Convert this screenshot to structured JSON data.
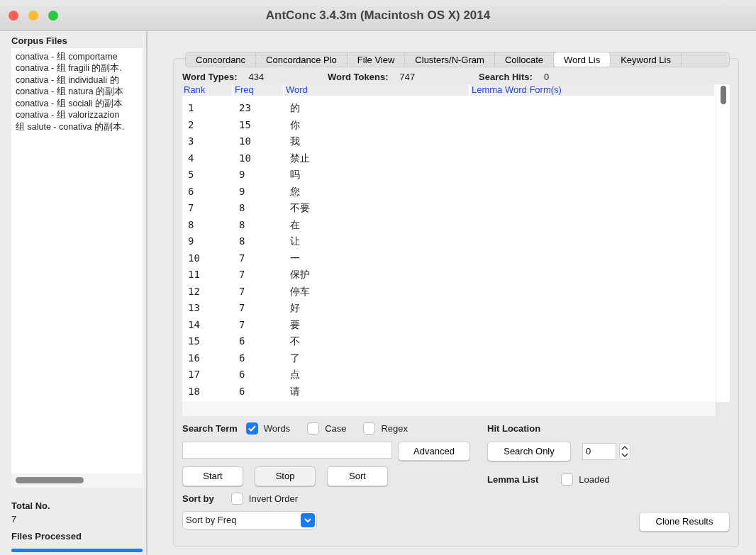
{
  "window": {
    "title": "AntConc 3.4.3m (Macintosh OS X) 2014"
  },
  "corpus_files": {
    "heading": "Corpus Files",
    "files": [
      "conativa - 组 comportame",
      "conativa - 组 fragili 的副本.",
      "conativa - 组 individuali 的",
      "conativa - 组 natura 的副本",
      "conativa - 组 sociali 的副本",
      "conativa - 组 valorizzazion",
      "组 salute - conativa 的副本."
    ]
  },
  "totals": {
    "total_label": "Total No.",
    "total_value": "7",
    "processed_label": "Files Processed",
    "level": 1
  },
  "tabs": [
    {
      "label": "Concordanc",
      "selected": false
    },
    {
      "label": "Concordance Plo",
      "selected": false
    },
    {
      "label": "File View",
      "selected": false
    },
    {
      "label": "Clusters/N-Gram",
      "selected": false
    },
    {
      "label": "Collocate",
      "selected": false
    },
    {
      "label": "Word Lis",
      "selected": true
    },
    {
      "label": "Keyword Lis",
      "selected": false
    }
  ],
  "stats": [
    {
      "label": "Word Types:",
      "value": "434"
    },
    {
      "label": "Word Tokens:",
      "value": "747"
    },
    {
      "label": "Search Hits:",
      "value": "0"
    }
  ],
  "table": {
    "columns": [
      "Rank",
      "Freq",
      "Word",
      "Lemma Word Form(s)"
    ],
    "rows": [
      [
        "1",
        "23",
        "的"
      ],
      [
        "2",
        "15",
        "你"
      ],
      [
        "3",
        "10",
        "我"
      ],
      [
        "4",
        "10",
        "禁止"
      ],
      [
        "5",
        "9",
        "吗"
      ],
      [
        "6",
        "9",
        "您"
      ],
      [
        "7",
        "8",
        "不要"
      ],
      [
        "8",
        "8",
        "在"
      ],
      [
        "9",
        "8",
        "让"
      ],
      [
        "10",
        "7",
        "一"
      ],
      [
        "11",
        "7",
        "保护"
      ],
      [
        "12",
        "7",
        "停车"
      ],
      [
        "13",
        "7",
        "好"
      ],
      [
        "14",
        "7",
        "要"
      ],
      [
        "15",
        "6",
        "不"
      ],
      [
        "16",
        "6",
        "了"
      ],
      [
        "17",
        "6",
        "点"
      ],
      [
        "18",
        "6",
        "请"
      ]
    ]
  },
  "search": {
    "label": "Search Term",
    "options": [
      {
        "label": "Words",
        "checked": true
      },
      {
        "label": "Case",
        "checked": false
      },
      {
        "label": "Regex",
        "checked": false
      }
    ],
    "advanced": "Advanced",
    "start": "Start",
    "stop": "Stop",
    "sort": "Sort"
  },
  "hit_location": {
    "label": "Hit Location",
    "button": "Search Only",
    "value": "0"
  },
  "lemma": {
    "label": "Lemma List",
    "option": "Loaded",
    "checked": false
  },
  "sort_by": {
    "label": "Sort by",
    "invert": "Invert Order",
    "invert_checked": false,
    "value": "Sort by Freq"
  },
  "clone": "Clone Results"
}
